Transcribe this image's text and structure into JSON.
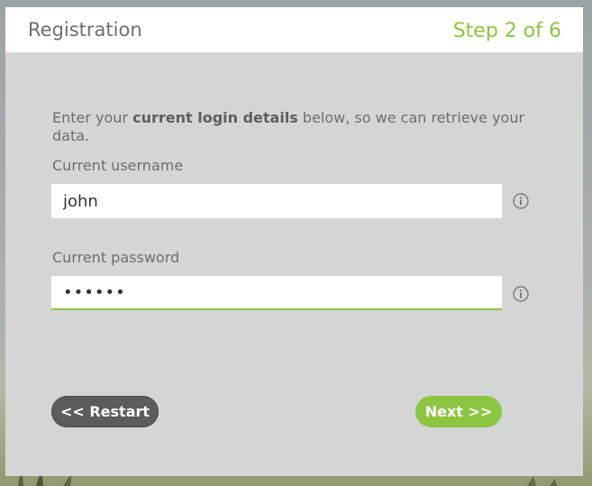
{
  "header": {
    "title": "Registration",
    "step": "Step 2 of 6"
  },
  "intro": {
    "prefix": "Enter your ",
    "bold": "current login details",
    "suffix": " below, so we can retrieve your data."
  },
  "username": {
    "label": "Current username",
    "value": "john"
  },
  "password": {
    "label": "Current password",
    "value": "••••••"
  },
  "buttons": {
    "restart": "<< Restart",
    "next": "Next >>"
  },
  "colors": {
    "accent": "#8cc540",
    "dark_button": "#5c5c5c",
    "panel": "#d4d6d6"
  }
}
